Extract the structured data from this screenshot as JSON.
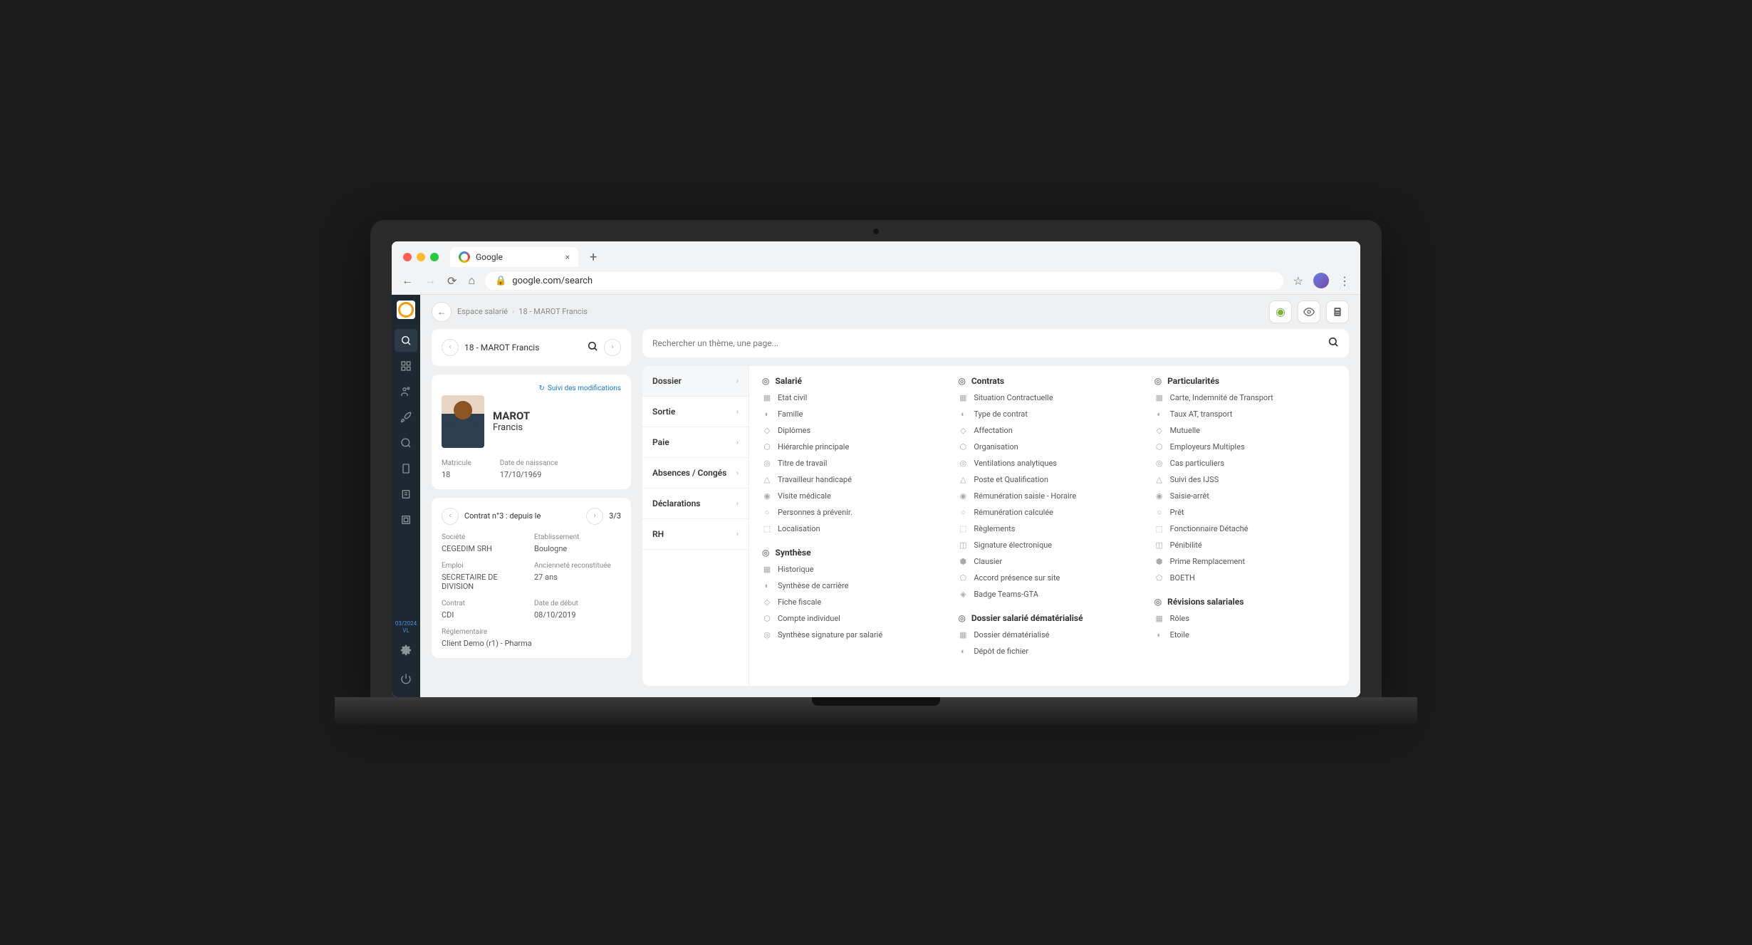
{
  "browser": {
    "tab_title": "Google",
    "url": "google.com/search"
  },
  "sidebar": {
    "date_line1": "03/2024",
    "date_line2": "VL"
  },
  "breadcrumb": {
    "root": "Espace salarié",
    "current": "18 - MAROT Francis"
  },
  "employee_selector": {
    "label": "18 - MAROT Francis"
  },
  "employee": {
    "track_label": "Suivi des modifications",
    "last_name": "MAROT",
    "first_name": "Francis",
    "matricule_label": "Matricule",
    "matricule_value": "18",
    "dob_label": "Date de naissance",
    "dob_value": "17/10/1969"
  },
  "contract": {
    "selector_label": "Contrat n°3 : depuis le",
    "count": "3/3",
    "fields": [
      {
        "label": "Société",
        "value": "CEGEDIM SRH"
      },
      {
        "label": "Etablissement",
        "value": "Boulogne"
      },
      {
        "label": "Emploi",
        "value": "SECRETAIRE DE DIVISION"
      },
      {
        "label": "Ancienneté reconstituée",
        "value": "27 ans"
      },
      {
        "label": "Contrat",
        "value": "CDI"
      },
      {
        "label": "Date de début",
        "value": "08/10/2019"
      },
      {
        "label": "Réglementaire",
        "value": "Client Demo (r1) - Pharma"
      }
    ]
  },
  "global_search": {
    "placeholder": "Rechercher un thème, une page..."
  },
  "categories": [
    {
      "label": "Dossier",
      "active": true
    },
    {
      "label": "Sortie"
    },
    {
      "label": "Paie"
    },
    {
      "label": "Absences / Congés"
    },
    {
      "label": "Déclarations"
    },
    {
      "label": "RH"
    }
  ],
  "sections": {
    "col1": [
      {
        "title": "Salarié",
        "items": [
          "Etat civil",
          "Famille",
          "Diplômes",
          "Hiérarchie principale",
          "Titre de travail",
          "Travailleur handicapé",
          "Visite médicale",
          "Personnes à prévenir.",
          "Localisation"
        ]
      },
      {
        "title": "Synthèse",
        "items": [
          "Historique",
          "Synthèse de carrière",
          "Fiche fiscale",
          "Compte individuel",
          "Synthèse signature par salarié"
        ]
      }
    ],
    "col2": [
      {
        "title": "Contrats",
        "items": [
          "Situation Contractuelle",
          "Type de contrat",
          "Affectation",
          "Organisation",
          "Ventilations analytiques",
          "Poste et Qualification",
          "Rémunération saisie - Horaire",
          "Rémunération calculée",
          "Règlements",
          "Signature électronique",
          "Clausier",
          "Accord présence sur site",
          "Badge Teams-GTA"
        ]
      },
      {
        "title": "Dossier salarié dématérialisé",
        "items": [
          "Dossier dématérialisé",
          "Dépôt de fichier"
        ]
      }
    ],
    "col3": [
      {
        "title": "Particularités",
        "items": [
          "Carte, Indemnité de Transport",
          "Taux AT, transport",
          "Mutuelle",
          "Employeurs Multiples",
          "Cas particuliers",
          "Suivi des IJSS",
          "Saisie-arrêt",
          "Prêt",
          "Fonctionnaire Détaché",
          "Pénibilité",
          "Prime Remplacement",
          "BOETH"
        ]
      },
      {
        "title": "Révisions salariales",
        "items": [
          "Rôles",
          "Etoile"
        ]
      }
    ]
  }
}
